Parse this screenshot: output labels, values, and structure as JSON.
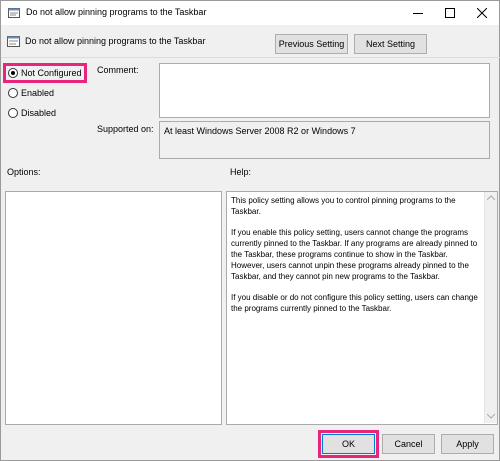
{
  "window": {
    "title": "Do not allow pinning programs to the Taskbar"
  },
  "header": {
    "policy_name": "Do not allow pinning programs to the Taskbar",
    "previous_label": "Previous Setting",
    "next_label": "Next Setting"
  },
  "state": {
    "options": [
      {
        "label": "Not Configured",
        "checked": true
      },
      {
        "label": "Enabled",
        "checked": false
      },
      {
        "label": "Disabled",
        "checked": false
      }
    ]
  },
  "comment": {
    "label": "Comment:",
    "value": ""
  },
  "supported": {
    "label": "Supported on:",
    "value": "At least Windows Server 2008 R2 or Windows 7"
  },
  "options_pane": {
    "label": "Options:"
  },
  "help_pane": {
    "label": "Help:",
    "paragraphs": [
      "This policy setting allows you to control pinning programs to the Taskbar.",
      "If you enable this policy setting, users cannot change the programs currently pinned to the Taskbar. If any programs are already pinned to the Taskbar, these programs continue to show in the Taskbar. However, users cannot unpin these programs already pinned to the Taskbar, and they cannot pin new programs to the Taskbar.",
      "If you disable or do not configure this policy setting, users can change the programs currently pinned to the Taskbar."
    ]
  },
  "footer": {
    "ok_label": "OK",
    "cancel_label": "Cancel",
    "apply_label": "Apply"
  },
  "colors": {
    "highlight": "#e8257a",
    "background": "#f0f0f0"
  }
}
